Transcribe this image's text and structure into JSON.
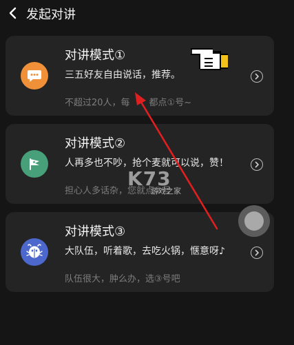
{
  "header": {
    "title": "发起对讲",
    "back_icon": "chevron-left-icon"
  },
  "cards": [
    {
      "title": "对讲模式①",
      "desc": "三五好友自由说话，推荐。",
      "note": "不超过20人，每",
      "note_tail": "都点①号~",
      "icon": "chat-bubble-icon",
      "icon_color": "#f0913a"
    },
    {
      "title": "对讲模式②",
      "desc": "人再多也不吵，抢个麦就可以说，赞！",
      "note": "担心人多话杂，您就点②号",
      "icon": "flag-icon",
      "icon_color": "#47a07a"
    },
    {
      "title": "对讲模式③",
      "desc": "大队伍，听着歌，去吃火锅，惬意呀♪",
      "note": "队伍很大，肿么办，选③号吧",
      "icon": "bug-mascot-icon",
      "icon_color": "#4d68cc"
    }
  ],
  "watermark": {
    "logo": "K73",
    "text": "游戏之家"
  },
  "colors": {
    "background": "#151515",
    "card": "#242424",
    "annotation_arrow": "#e02020"
  }
}
